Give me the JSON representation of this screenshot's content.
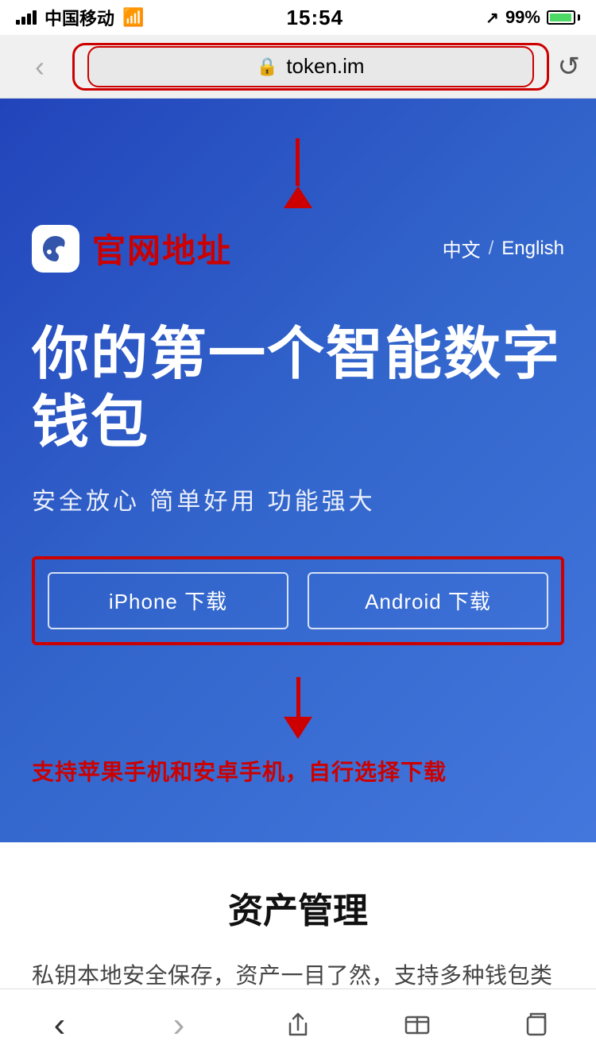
{
  "statusBar": {
    "carrier": "中国移动",
    "time": "15:54",
    "battery": "99%",
    "signal": true,
    "wifi": true,
    "gps": true
  },
  "browserBar": {
    "url": "token.im",
    "refreshIcon": "↺"
  },
  "hero": {
    "logoText": "官网地址",
    "langCN": "中文",
    "divider": "/",
    "langEN": "English",
    "title": "你的第一个智能数字钱包",
    "subtitle": "安全放心  简单好用  功能强大",
    "iphoneBtn": "iPhone 下载",
    "androidBtn": "Android 下载",
    "supportText": "支持苹果手机和安卓手机，自行选择下载"
  },
  "assetSection": {
    "title": "资产管理",
    "description": "私钥本地安全保存，资产一目了然，支持多种钱包类型，轻松导入导出，助记词备份防丢，多重签名防盗"
  },
  "bottomNav": {
    "back": "‹",
    "forward": "›",
    "share": "share",
    "bookmarks": "bookmarks",
    "tabs": "tabs"
  }
}
